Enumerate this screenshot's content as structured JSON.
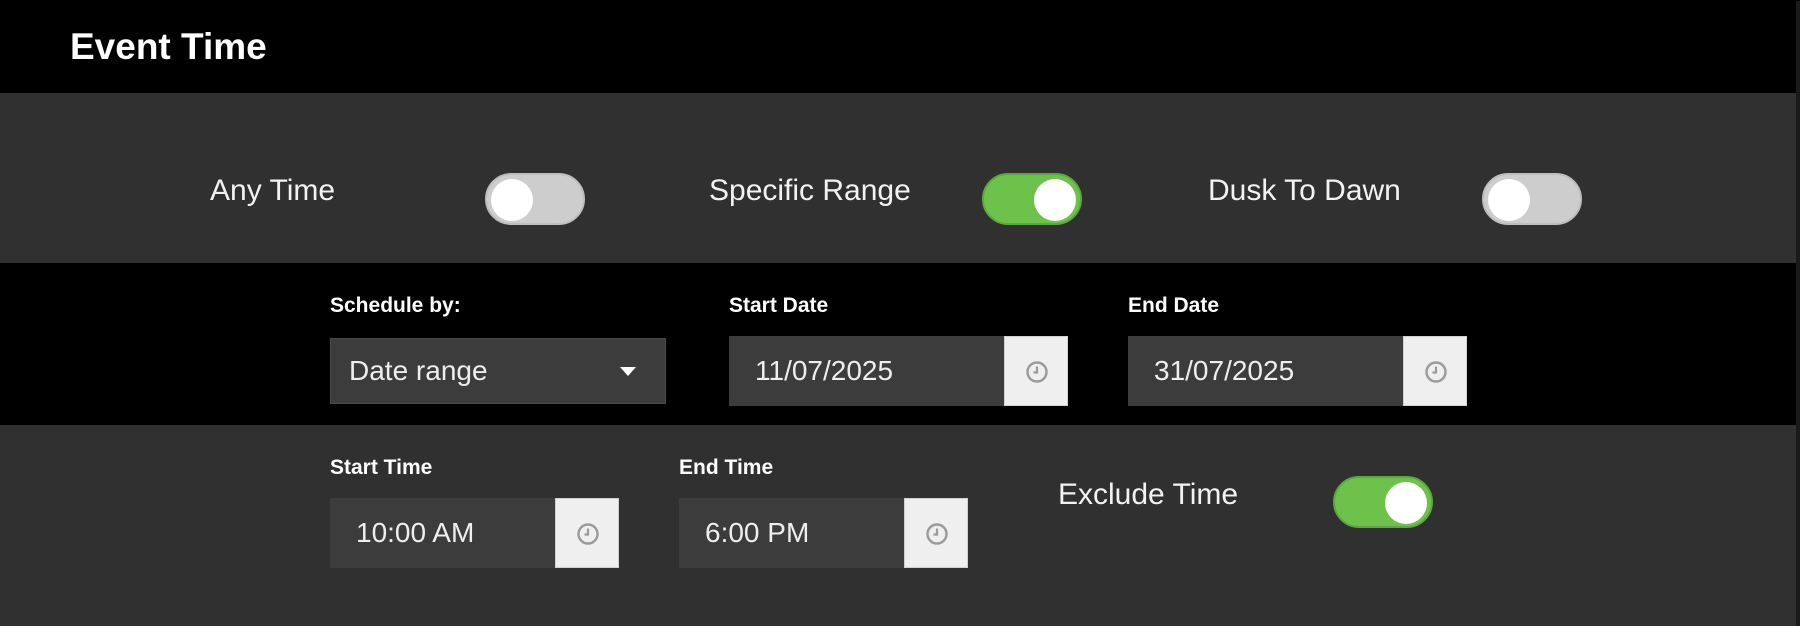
{
  "header": {
    "title": "Event Time"
  },
  "modes": {
    "any_time": {
      "label": "Any Time",
      "enabled": false
    },
    "specific_range": {
      "label": "Specific Range",
      "enabled": true
    },
    "dusk_to_dawn": {
      "label": "Dusk To Dawn",
      "enabled": false
    }
  },
  "schedule": {
    "schedule_by_label": "Schedule by:",
    "schedule_by_value": "Date range",
    "start_date_label": "Start Date",
    "start_date_value": "11/07/2025",
    "end_date_label": "End Date",
    "end_date_value": "31/07/2025"
  },
  "times": {
    "start_time_label": "Start Time",
    "start_time_value": "10:00 AM",
    "end_time_label": "End Time",
    "end_time_value": "6:00 PM",
    "exclude_time_label": "Exclude Time",
    "exclude_time_enabled": true
  },
  "icons": {
    "picker": "clock-icon",
    "dropdown": "caret-down-icon"
  },
  "colors": {
    "toggle_on": "#6cc24a",
    "toggle_off": "#cdcdcd",
    "panel_bg": "#303030",
    "header_bg": "#000000"
  }
}
